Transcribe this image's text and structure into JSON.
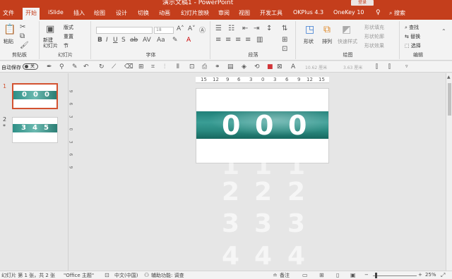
{
  "titlebar": {
    "title": "演示文稿1 - PowerPoint",
    "login": "登录"
  },
  "tabs": [
    {
      "label": "文件"
    },
    {
      "label": "开始"
    },
    {
      "label": "iSlide"
    },
    {
      "label": "插入"
    },
    {
      "label": "绘图"
    },
    {
      "label": "设计"
    },
    {
      "label": "切换"
    },
    {
      "label": "动画"
    },
    {
      "label": "幻灯片放映"
    },
    {
      "label": "审阅"
    },
    {
      "label": "视图"
    },
    {
      "label": "开发工具"
    },
    {
      "label": "OKPlus 4.3"
    },
    {
      "label": "OneKey 10"
    }
  ],
  "active_tab": "开始",
  "search_label": "搜索",
  "ribbon": {
    "groups": {
      "clipboard": "剪贴板",
      "slides": "幻灯片",
      "font": "字体",
      "paragraph": "段落",
      "drawing": "绘图",
      "editing": "编辑"
    },
    "paste": "粘贴",
    "new_slide": "新建\n幻灯片",
    "layout": "版式",
    "reset": "重置",
    "section": "节",
    "font_size": "18",
    "shape": "形状",
    "arrange": "排列",
    "quick_styles": "快速样式",
    "shape_fill": "形状填充",
    "shape_outline": "形状轮廓",
    "shape_effects": "形状效果",
    "find": "查找",
    "replace": "替换",
    "select": "选择"
  },
  "qat": {
    "autosave": "自动保存",
    "toggle": "关",
    "dim1": "10.62 厘米",
    "dim2": "3.63 厘米"
  },
  "thumbnails": [
    {
      "num": "1",
      "digits": [
        "0",
        "0",
        "0"
      ]
    },
    {
      "num": "2",
      "digits": [
        "3",
        "4",
        "5"
      ],
      "mark": "*"
    }
  ],
  "ruler_h": [
    "15",
    "12",
    "9",
    "6",
    "3",
    "0",
    "3",
    "6",
    "9",
    "12",
    "15"
  ],
  "ruler_v": [
    "9",
    "6",
    "3",
    "0",
    "3",
    "6",
    "9"
  ],
  "slide": {
    "digits": [
      "0",
      "0",
      "0"
    ]
  },
  "ghost_rows": [
    [
      "1",
      "1",
      "1"
    ],
    [
      "2",
      "2",
      "2"
    ],
    [
      "3",
      "3",
      "3"
    ],
    [
      "4",
      "4",
      "4"
    ]
  ],
  "statusbar": {
    "slide_info": "幻灯片 第 1 张，共 2 张",
    "theme": "\"Office 主题\"",
    "language": "中文(中国)",
    "accessibility": "辅助功能: 调查",
    "notes": "备注",
    "zoom": "25%"
  }
}
